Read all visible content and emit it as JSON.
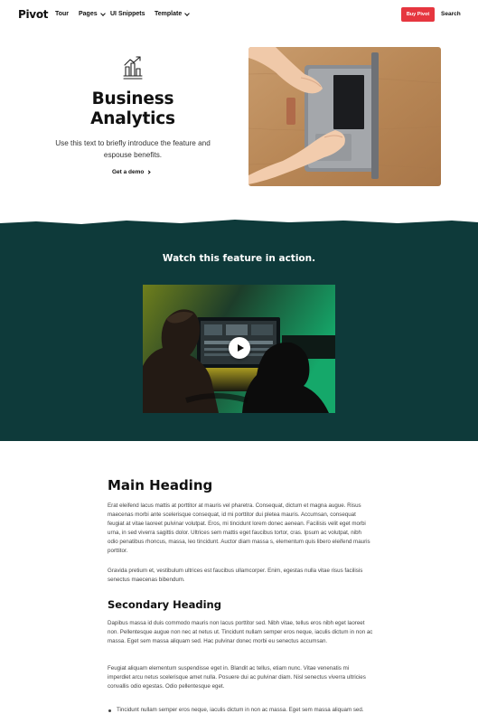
{
  "nav": {
    "logo": "Pivot",
    "items": [
      {
        "label": "Tour"
      },
      {
        "label": "Pages"
      },
      {
        "label": "UI Snippets"
      },
      {
        "label": "Template"
      }
    ],
    "buy_label": "Buy Pivot",
    "search_label": "Search"
  },
  "hero": {
    "icon": "analytics-chart-icon",
    "title_line1": "Business",
    "title_line2": "Analytics",
    "text": "Use this text to briefly introduce the feature and espouse benefits.",
    "cta_label": "Get a demo"
  },
  "feature": {
    "title": "Watch this feature in action.",
    "band_color": "#0e3a3a"
  },
  "article": {
    "main_heading": "Main Heading",
    "p1": "Erat eleifend lacus mattis at porttitor at mauris vel pharetra. Consequat, dictum et magna augue. Risus maecenas morbi ante scelerisque consequat, id mi porttitor dui pletea mauris. Accumsan, consequat feugiat at vitae laoreet pulvinar volutpat. Eros, mi tincidunt lorem donec aenean. Facilisis velit eget morbi urna, in sed viverra sagittis dolor. Ultrices sem mattis eget faucibus tortor, cras. Ipsum ac volutpat, nibh odio penatibus rhoncus, massa, leo tincidunt. Auctor diam massa s, elementum quis libero eleifend mauris porttitor.",
    "p2": "Gravida pretium et, vestibulum ultrices est faucibus ullamcorper. Enim, egestas nulla vitae risus facilisis senectus maecenas bibendum.",
    "secondary_heading": "Secondary Heading",
    "p3": "Dapibus massa id duis commodo mauris non lacus porttitor sed. Nibh vitae, tellus eros nibh eget laoreet non. Pellentesque augue non nec at netus ut. Tincidunt nullam semper eros neque, iaculis dictum in non ac massa. Eget sem massa aliquam sed. Hac pulvinar donec morbi eu senectus accumsan.",
    "p4": "Feugiat aliquam elementum suspendisse eget in. Blandit ac tellus, etiam nunc. Vitae venenatis mi imperdiet arcu netus scelerisque amet nulla. Posuere dui ac pulvinar diam. Nisl senectus viverra ultricies convallis odio egestas. Odio pellentesque eget.",
    "list": [
      "Tincidunt nullam semper eros neque, iaculis dictum in non ac massa. Eget sem massa aliquam sed."
    ]
  }
}
